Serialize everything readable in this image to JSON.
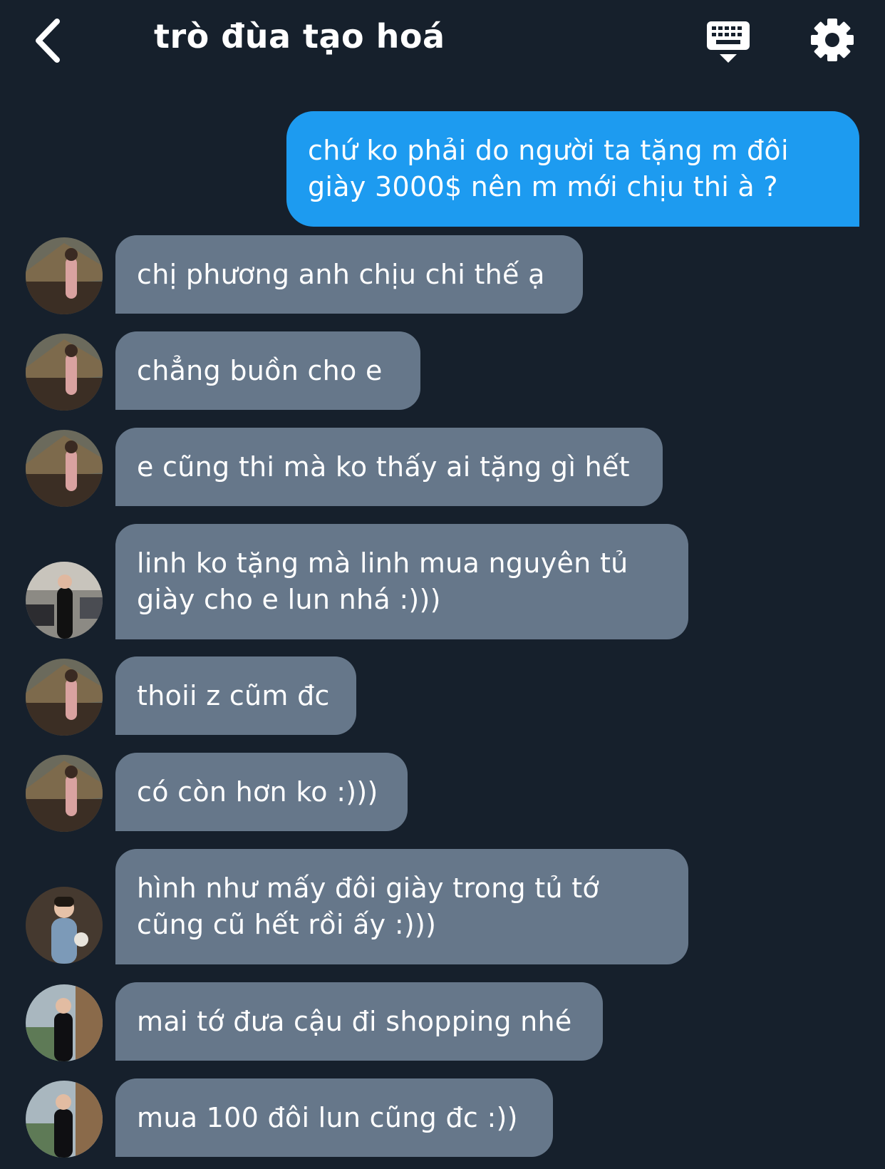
{
  "header": {
    "title": "trò đùa tạo hoá",
    "back_icon": "chevron-left-icon",
    "keyboard_icon": "keyboard-icon",
    "settings_icon": "gear-icon"
  },
  "colors": {
    "background": "#16202c",
    "outgoing_bubble": "#1d9bf0",
    "incoming_bubble": "#66778a",
    "text": "#ffffff"
  },
  "messages": [
    {
      "sender": "me",
      "text": "chứ ko phải do người ta tặng m đôi\ngiày 3000$ nên m mới chịu thi à ?"
    },
    {
      "sender": "user-a",
      "text": "chị phương anh chịu chi thế ạ"
    },
    {
      "sender": "user-a",
      "text": "chẳng buồn cho e"
    },
    {
      "sender": "user-a",
      "text": "e cũng thi mà ko thấy ai tặng gì hết"
    },
    {
      "sender": "user-b",
      "text": "linh ko tặng mà linh mua nguyên tủ\ngiày cho e lun nhá :)))"
    },
    {
      "sender": "user-a",
      "text": "thoii z cũm đc"
    },
    {
      "sender": "user-a",
      "text": "có còn hơn ko :)))"
    },
    {
      "sender": "user-c",
      "text": "hình như mấy đôi giày trong tủ tớ\ncũng cũ hết rồi ấy :)))"
    },
    {
      "sender": "user-d",
      "text": "mai tớ đưa cậu đi shopping nhé"
    },
    {
      "sender": "user-d",
      "text": "mua 100 đôi lun cũng đc :))"
    }
  ]
}
